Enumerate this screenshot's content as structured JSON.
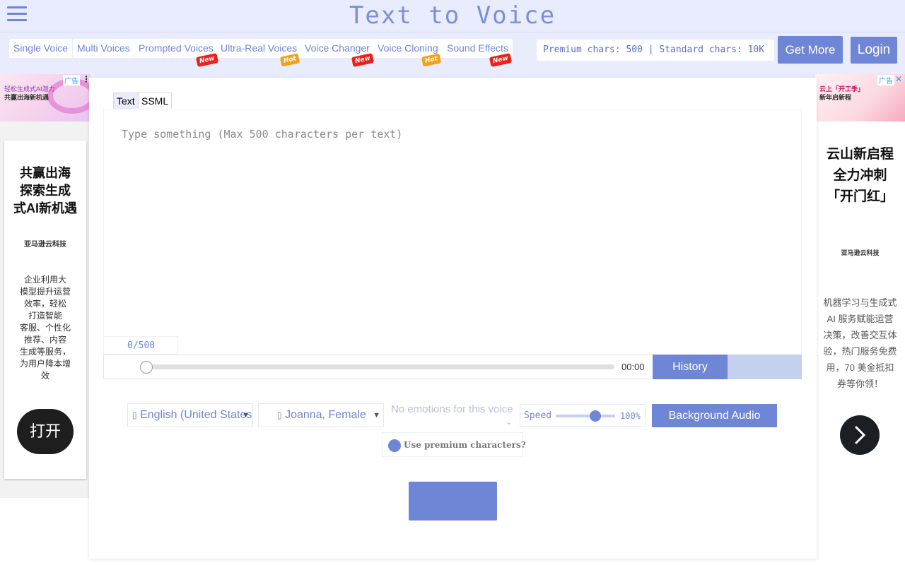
{
  "header": {
    "title": "Text to Voice",
    "nav": [
      {
        "label": "Single Voice",
        "badge": ""
      },
      {
        "label": "Multi Voices",
        "badge": ""
      },
      {
        "label": "Prompted Voices",
        "badge": "New"
      },
      {
        "label": "Ultra-Real Voices",
        "badge": "Hot"
      },
      {
        "label": "Voice Changer",
        "badge": "New"
      },
      {
        "label": "Voice Cloning",
        "badge": "Hot"
      },
      {
        "label": "Sound Effects",
        "badge": "New"
      }
    ],
    "chars_info": "Premium chars: 500 | Standard chars: 10K",
    "get_more_label": "Get More",
    "login_label": "Login"
  },
  "ad_left": {
    "mark": "广告",
    "banner_line1": "轻松生成式AI潜力",
    "banner_line2": "共赢出海新机遇",
    "headline": [
      "共赢出海",
      "探索生成",
      "式AI新机遇"
    ],
    "brand": "亚马逊云科技",
    "body": [
      "企业利用大",
      "模型提升运营",
      "效率，轻松",
      "打造智能",
      "客服、个性化",
      "推荐、内容",
      "生成等服务，",
      "为用户降本增",
      "效"
    ],
    "cta": "打开"
  },
  "ad_right": {
    "mark": "广告",
    "banner_line1": "云上「开工季」",
    "banner_line2": "新年启新程",
    "headline": [
      "云山新启程",
      "全力冲刺",
      "「开门红」"
    ],
    "brand": "亚马逊云科技",
    "body": [
      "机器学习与生成式",
      "AI 服务赋能运营",
      "决策，改善交互体",
      "验，热门服务免费",
      "用，70 美金抵扣",
      "券等你领！"
    ]
  },
  "editor": {
    "tabs": [
      "Text",
      "SSML"
    ],
    "placeholder": "Type something (Max 500 characters per text)",
    "counter": "0/500"
  },
  "player": {
    "time": "00:00",
    "history_label": "History",
    "progress": 0
  },
  "controls": {
    "language": "English (United States)",
    "voice": "Joanna, Female",
    "emotion": "No emotions for this voice",
    "speed_label": "Speed",
    "speed_value": "100%",
    "speed_fraction": 0.5,
    "background_audio_label": "Background Audio",
    "premium_toggle": "Use premium characters?"
  },
  "icons": {
    "menu": "hamburger-icon",
    "flag": "flag-icon",
    "voice": "person-icon",
    "next": "chevron-right-icon"
  },
  "colors": {
    "accent": "#6f85d6",
    "header_bg": "#e8ecfc",
    "new_badge": "#e8231c",
    "hot_badge": "#f0a21c"
  }
}
